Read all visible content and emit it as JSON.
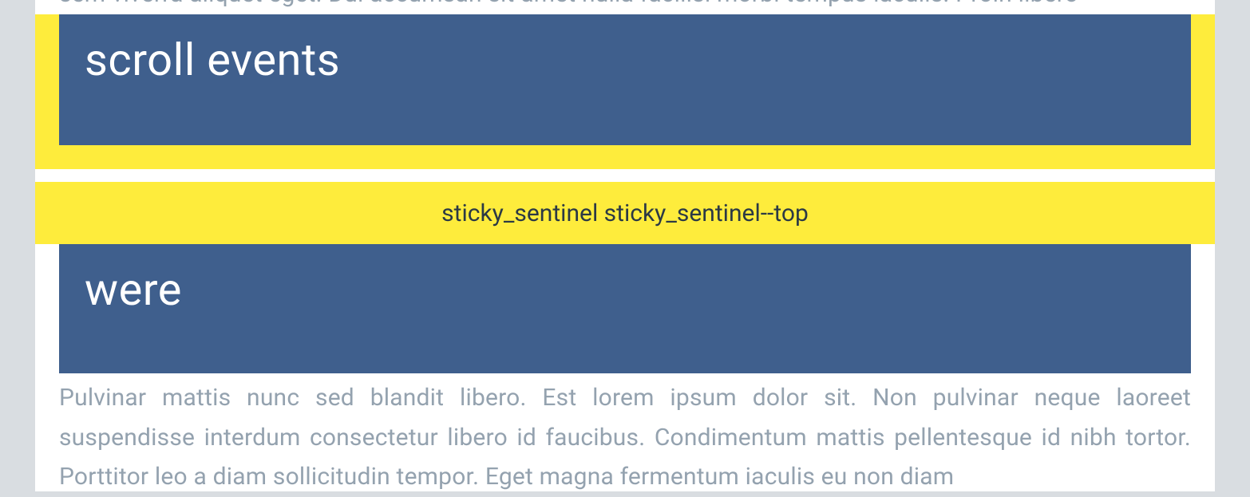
{
  "sections": [
    {
      "para_fragment": "sem viverra aliquet eget. Dui accumsan sit amet nulla facilisi morbi tempus iaculis. Proin libero",
      "header": "scroll events"
    },
    {
      "sentinel_label": "sticky_sentinel sticky_sentinel--top",
      "header": "were",
      "para": "Pulvinar mattis nunc sed blandit libero. Est lorem ipsum dolor sit. Non pulvinar neque laoreet suspendisse interdum consectetur libero id faucibus. Condimentum mattis pellentesque id nibh tortor. Porttitor leo a diam sollicitudin tempor. Eget magna fermentum iaculis eu non diam"
    }
  ],
  "colors": {
    "page_bg": "#d9dde1",
    "card_bg": "#ffffff",
    "header_bg": "#3f5f8d",
    "header_text": "#ffffff",
    "sentinel_bg": "#feec3c",
    "body_text": "#94a2af",
    "sentinel_text": "#2b3945"
  }
}
